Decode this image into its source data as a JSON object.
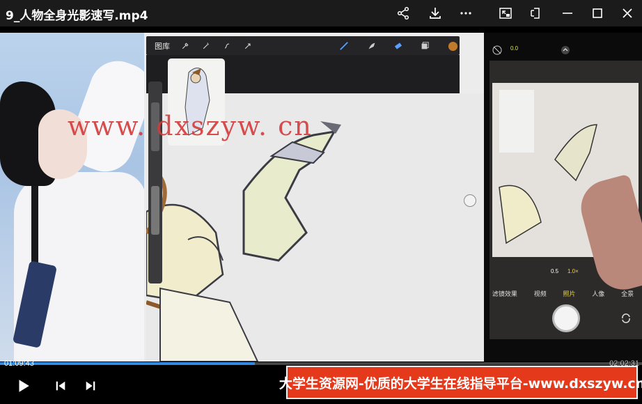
{
  "window": {
    "title": "9_人物全身光影速写.mp4"
  },
  "titlebar_icons": [
    "share-icon",
    "download-icon",
    "more-icon",
    "picture-in-picture-icon",
    "pin-icon",
    "minimize-icon",
    "maximize-icon",
    "close-icon"
  ],
  "video": {
    "watermark": "www. dxszyw. cn",
    "procreate": {
      "gallery_label": "图库"
    },
    "phone": {
      "top_value": "0.0",
      "zoom_levels": [
        "0.5",
        "1.0×"
      ],
      "modes": [
        "滤镜效果",
        "视频",
        "照片",
        "人像",
        "全景"
      ]
    }
  },
  "player": {
    "current_time": "01:09:43",
    "total_time": "02:02:31",
    "progress_fraction": 0.397
  },
  "banner": {
    "text": "大学生资源网-优质的大学生在线指导平台-www.dxszyw.cn"
  },
  "colors": {
    "banner_bg": "#e5391c",
    "progress": "#2f8ae0",
    "watermark": "#d43b3b"
  }
}
